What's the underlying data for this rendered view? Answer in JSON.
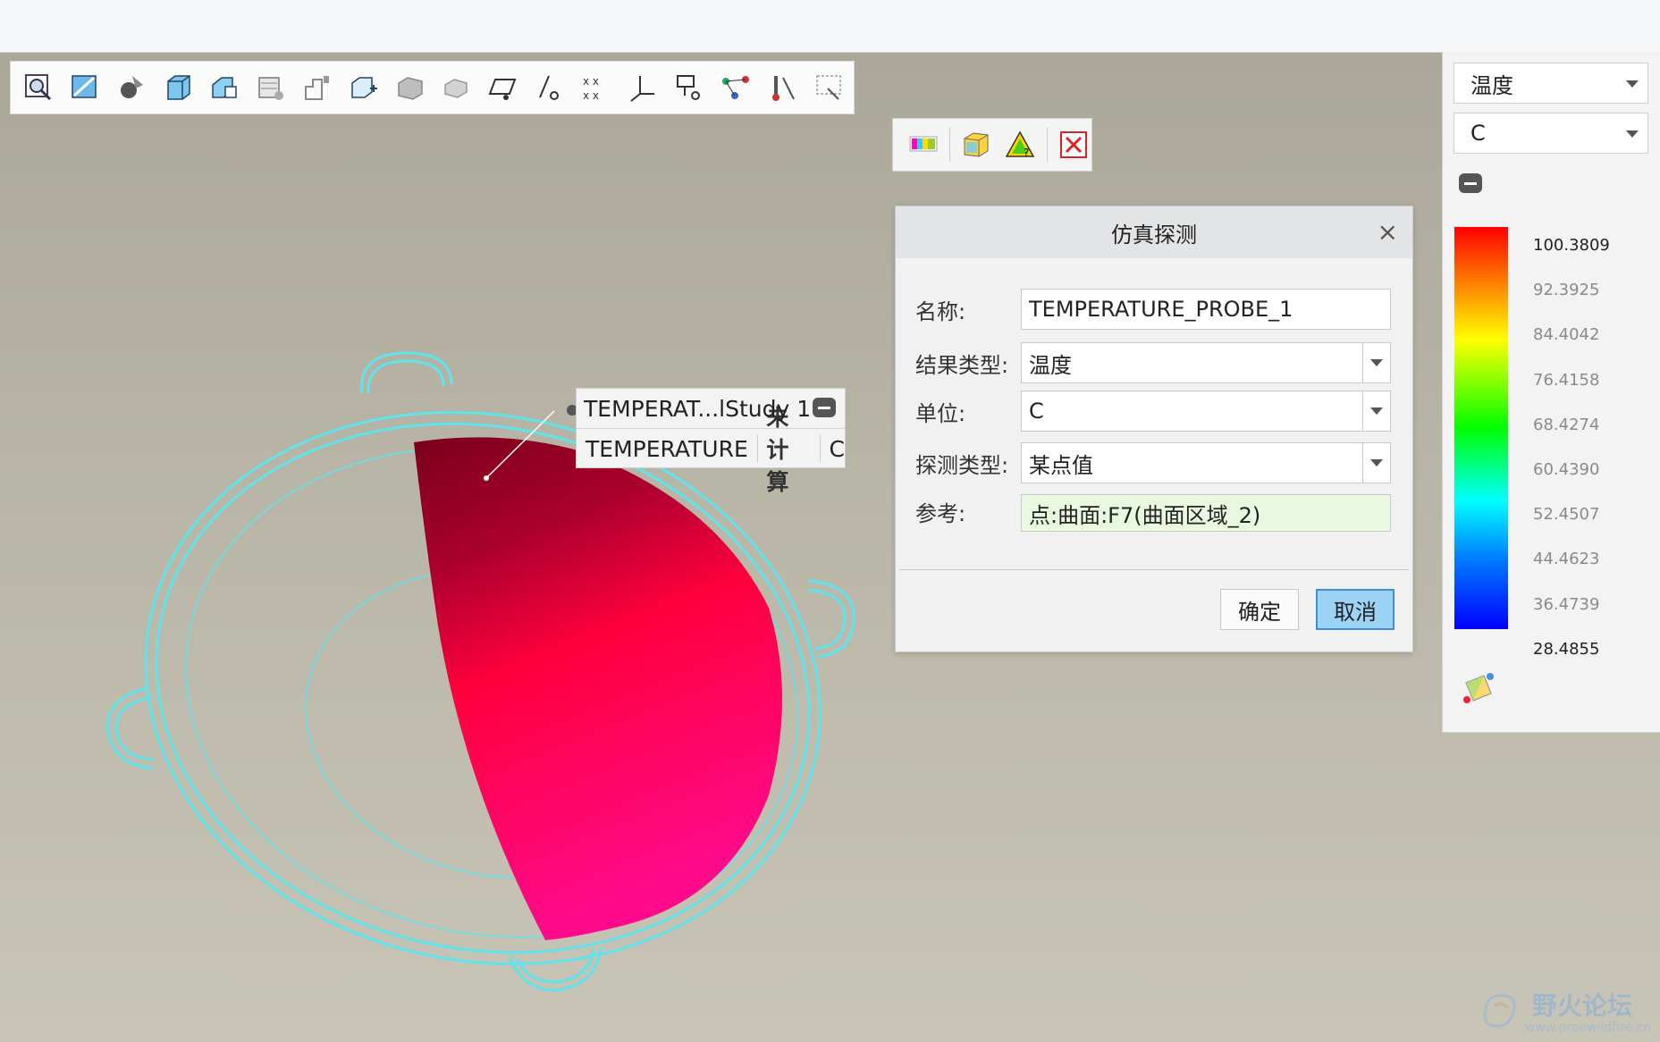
{
  "toolbar": {
    "icons": [
      "zoom-area-icon",
      "view-direction-icon",
      "shading-icon",
      "view-box-icon",
      "saved-views-icon",
      "appearance-icon",
      "datum-planes-icon",
      "axis-display-icon",
      "point-display-icon",
      "csys-display-icon",
      "annotation-display-icon",
      "layer-icon",
      "sim-display-icon",
      "spin-center-icon",
      "mesh-display-icon",
      "model-tree-icon",
      "probe-icon",
      "settings-icon"
    ]
  },
  "mini_toolbar": {
    "icons": [
      "fringe-plot-icon",
      "cube-result-icon",
      "triangle-result-icon",
      "close-result-icon"
    ]
  },
  "callout": {
    "title": "TEMPERAT...lStudy 1",
    "field": "TEMPERATURE",
    "status": "未计算",
    "unit": "C"
  },
  "dialog": {
    "title": "仿真探测",
    "name_label": "名称:",
    "name_value": "TEMPERATURE_PROBE_1",
    "result_type_label": "结果类型:",
    "result_type_value": "温度",
    "unit_label": "单位:",
    "unit_value": "C",
    "probe_type_label": "探测类型:",
    "probe_type_value": "某点值",
    "reference_label": "参考:",
    "reference_value": "点:曲面:F7(曲面区域_2)",
    "ok_label": "确定",
    "cancel_label": "取消"
  },
  "legend": {
    "quantity": "温度",
    "unit": "C",
    "ticks": [
      "100.3809",
      "92.3925",
      "84.4042",
      "76.4158",
      "68.4274",
      "60.4390",
      "52.4507",
      "44.4623",
      "36.4739",
      "28.4855"
    ],
    "colors": [
      "#ff0000",
      "#ff8000",
      "#ffff00",
      "#00ff00",
      "#00ffff",
      "#0080ff",
      "#0000ff"
    ]
  },
  "watermark": {
    "text": "野火论坛",
    "url": "www.proewildfire.cn"
  }
}
